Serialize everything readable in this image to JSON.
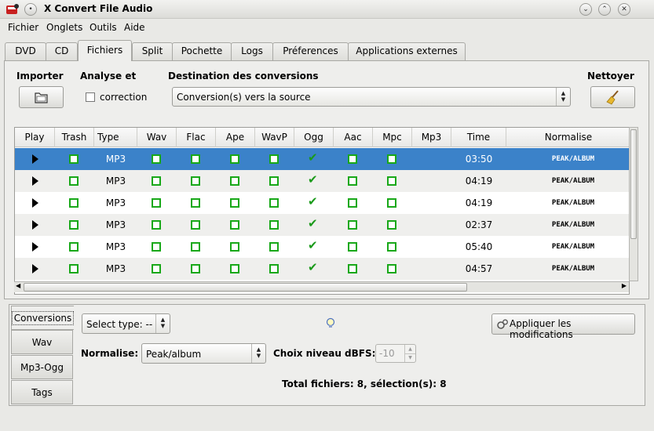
{
  "window": {
    "title": "X Convert File Audio"
  },
  "menu": [
    "Fichier",
    "Onglets",
    "Outils",
    "Aide"
  ],
  "tabs": [
    "DVD",
    "CD",
    "Fichiers",
    "Split",
    "Pochette",
    "Logs",
    "Préferences",
    "Applications externes"
  ],
  "import": {
    "label": "Importer"
  },
  "analyse": {
    "label": "Analyse et",
    "checkbox_label": "correction"
  },
  "destination": {
    "label": "Destination des conversions",
    "value": "Conversion(s) vers la source"
  },
  "cleanup": {
    "label": "Nettoyer"
  },
  "table": {
    "headers": [
      "Play",
      "Trash",
      "Type",
      "Wav",
      "Flac",
      "Ape",
      "WavP",
      "Ogg",
      "Aac",
      "Mpc",
      "Mp3",
      "Time",
      "Normalise"
    ],
    "rows": [
      {
        "type": "MP3",
        "time": "03:50",
        "normalise": "PEAK/ALBUM"
      },
      {
        "type": "MP3",
        "time": "04:19",
        "normalise": "PEAK/ALBUM"
      },
      {
        "type": "MP3",
        "time": "04:19",
        "normalise": "PEAK/ALBUM"
      },
      {
        "type": "MP3",
        "time": "02:37",
        "normalise": "PEAK/ALBUM"
      },
      {
        "type": "MP3",
        "time": "05:40",
        "normalise": "PEAK/ALBUM"
      },
      {
        "type": "MP3",
        "time": "04:57",
        "normalise": "PEAK/ALBUM"
      }
    ]
  },
  "side_tabs": [
    "Conversions",
    "Wav",
    "Mp3-Ogg",
    "Tags"
  ],
  "conversions": {
    "select_type": "Select type: --",
    "apply_label": "Appliquer les modifications",
    "normalise_label": "Normalise:",
    "normalise_value": "Peak/album",
    "dbfs_label": "Choix niveau dBFS:",
    "dbfs_value": "-10",
    "total": "Total fichiers: 8,  sélection(s): 8"
  },
  "colors": {
    "selection": "#3b82c9",
    "check_green": "#18a818"
  }
}
